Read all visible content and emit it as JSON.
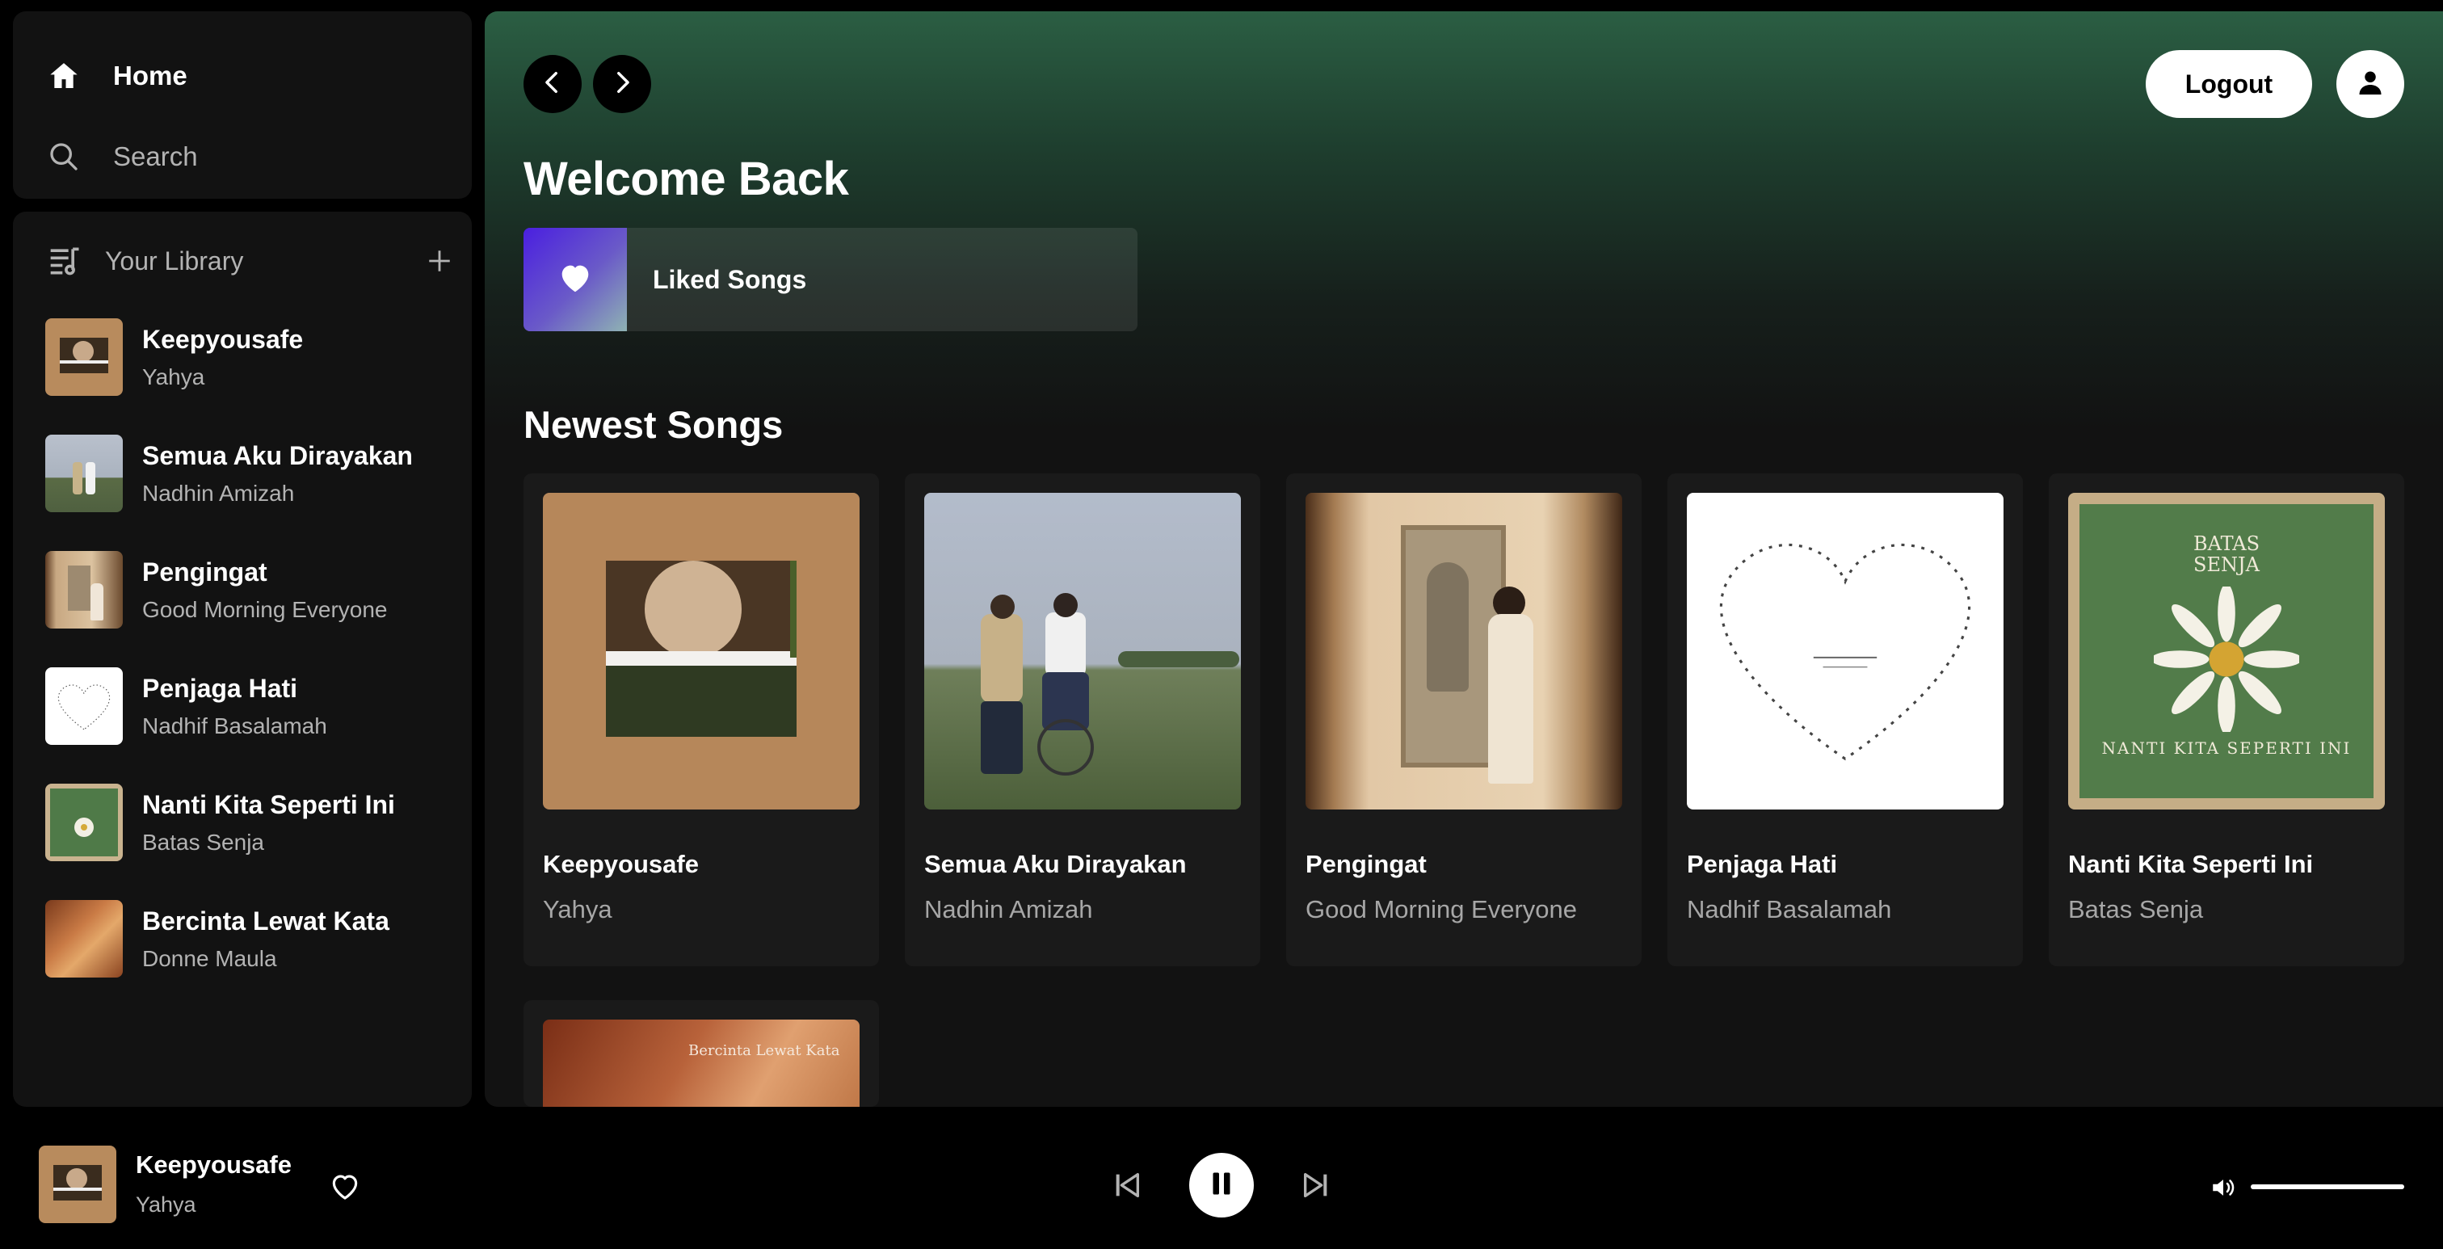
{
  "sidebar": {
    "nav": {
      "home": "Home",
      "search": "Search"
    },
    "library": {
      "title": "Your Library",
      "items": [
        {
          "title": "Keepyousafe",
          "artist": "Yahya"
        },
        {
          "title": "Semua Aku Dirayakan",
          "artist": "Nadhin Amizah"
        },
        {
          "title": "Pengingat",
          "artist": "Good Morning Everyone"
        },
        {
          "title": "Penjaga Hati",
          "artist": "Nadhif Basalamah"
        },
        {
          "title": "Nanti Kita Seperti Ini",
          "artist": "Batas Senja"
        },
        {
          "title": "Bercinta Lewat Kata",
          "artist": "Donne Maula"
        }
      ]
    }
  },
  "header": {
    "logout": "Logout"
  },
  "main": {
    "welcome": "Welcome Back",
    "liked_songs": "Liked Songs",
    "section_title": "Newest Songs",
    "cards": [
      {
        "title": "Keepyousafe",
        "artist": "Yahya"
      },
      {
        "title": "Semua Aku Dirayakan",
        "artist": "Nadhin Amizah"
      },
      {
        "title": "Pengingat",
        "artist": "Good Morning Everyone"
      },
      {
        "title": "Penjaga Hati",
        "artist": "Nadhif Basalamah"
      },
      {
        "title": "Nanti Kita Seperti Ini",
        "artist": "Batas Senja"
      }
    ],
    "partial_card": {
      "art_text": "Bercinta Lewat Kata"
    }
  },
  "album_art_text": {
    "batas_senja_logo": "BATAS SENJA",
    "batas_senja_sub": "NANTI KITA SEPERTI INI"
  },
  "player": {
    "title": "Keepyousafe",
    "artist": "Yahya",
    "state": "playing",
    "volume": 1.0
  },
  "colors": {
    "accent_gradient_top": "#2b5e43",
    "background": "#121212",
    "liked_gradient": [
      "#4a1fe0",
      "#8fb3b3"
    ]
  },
  "icons": [
    "home-icon",
    "search-icon",
    "library-icon",
    "plus-icon",
    "chevron-left-icon",
    "chevron-right-icon",
    "user-icon",
    "heart-icon",
    "skip-back-icon",
    "pause-icon",
    "skip-forward-icon",
    "volume-icon"
  ]
}
